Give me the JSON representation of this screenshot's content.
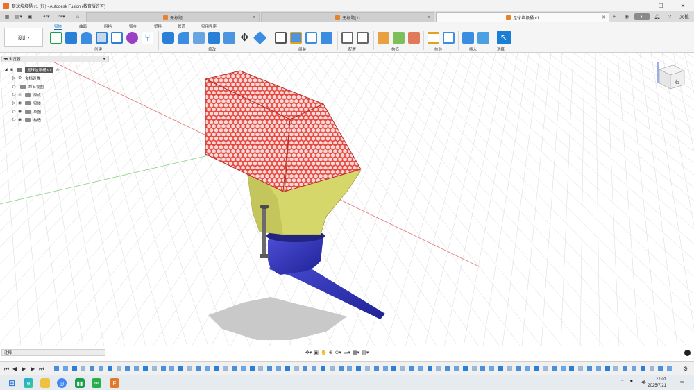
{
  "window": {
    "title": "足球垃圾桶 v1 (好) - Autodesk Fusion (教育版许可)"
  },
  "tabs": [
    {
      "label": "无标题"
    },
    {
      "label": "无标题(1)"
    },
    {
      "label": "足球垃圾桶 v1"
    }
  ],
  "toolbar_right": {
    "user_initials": "文植"
  },
  "ribbon": {
    "workspace": "设计",
    "tabs": [
      "实体",
      "曲面",
      "网格",
      "钣金",
      "塑料",
      "管道",
      "实用程序"
    ],
    "groups": [
      "创建",
      "修改",
      "组装",
      "配置",
      "构造",
      "检验",
      "插入",
      "选择"
    ]
  },
  "browser": {
    "title": "浏览器",
    "root": "足球垃圾桶 v1",
    "items": [
      "文档设置",
      "命名视图",
      "原点",
      "实体",
      "草图",
      "构造"
    ]
  },
  "comments": {
    "label": "注释"
  },
  "viewcube": {
    "label": "右"
  },
  "taskbar": {
    "ime": "英",
    "time": "22:07",
    "date": "2025/7/21"
  },
  "colors": {
    "mesh_red": "#e8463f",
    "hopper_yellow": "#d6d76a",
    "base_blue": "#2c2fb8",
    "ribbon_blue": "#0a6dc2"
  }
}
